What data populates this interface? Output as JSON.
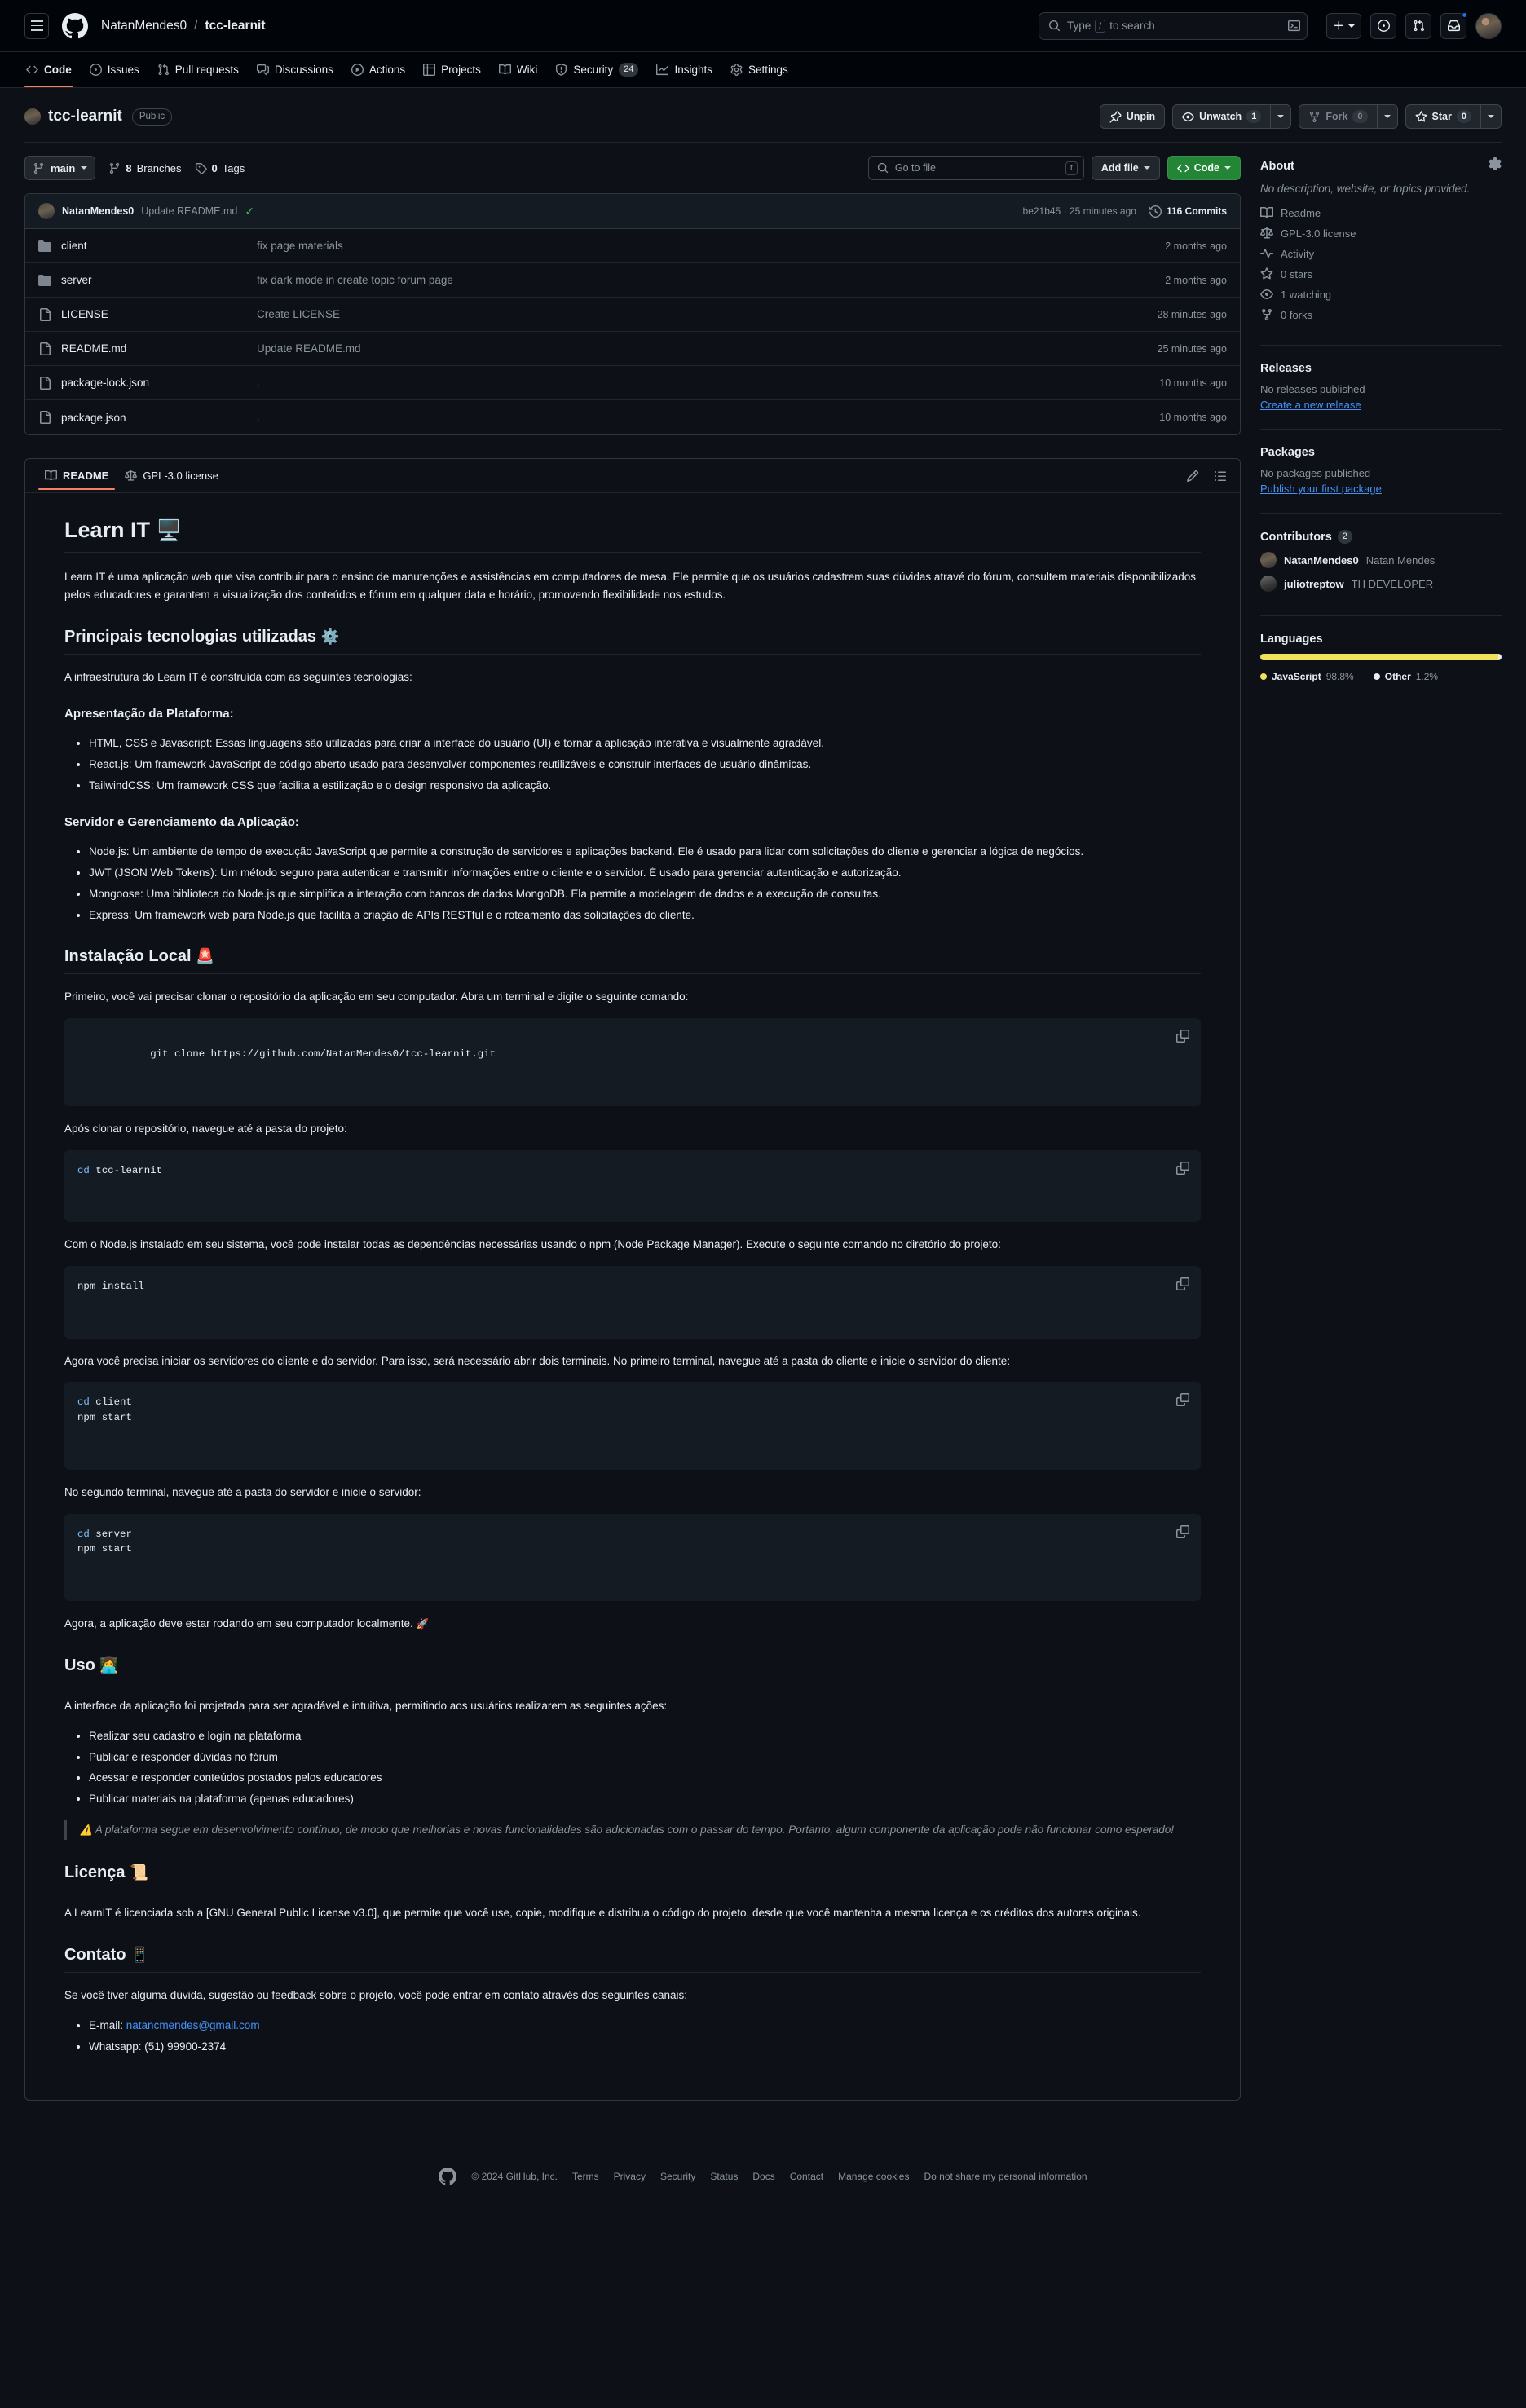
{
  "header": {
    "owner": "NatanMendes0",
    "separator": "/",
    "repo": "tcc-learnit",
    "search_placeholder": "Type",
    "search_key": "/",
    "search_suffix": "to search"
  },
  "repo_nav": [
    {
      "label": "Code",
      "icon": "code-icon",
      "badge": ""
    },
    {
      "label": "Issues",
      "icon": "issue-opened-icon",
      "badge": ""
    },
    {
      "label": "Pull requests",
      "icon": "git-pull-request-icon",
      "badge": ""
    },
    {
      "label": "Discussions",
      "icon": "comment-discussion-icon",
      "badge": ""
    },
    {
      "label": "Actions",
      "icon": "play-icon",
      "badge": ""
    },
    {
      "label": "Projects",
      "icon": "table-icon",
      "badge": ""
    },
    {
      "label": "Wiki",
      "icon": "book-icon",
      "badge": ""
    },
    {
      "label": "Security",
      "icon": "shield-icon",
      "badge": "24"
    },
    {
      "label": "Insights",
      "icon": "graph-icon",
      "badge": ""
    },
    {
      "label": "Settings",
      "icon": "gear-icon",
      "badge": ""
    }
  ],
  "repo_header": {
    "name": "tcc-learnit",
    "visibility": "Public",
    "unpin_label": "Unpin",
    "unwatch_label": "Unwatch",
    "unwatch_count": "1",
    "fork_label": "Fork",
    "fork_count": "0",
    "star_label": "Star",
    "star_count": "0"
  },
  "file_bar": {
    "branch": "main",
    "branches_count": "8",
    "branches_label": "Branches",
    "tags_count": "0",
    "tags_label": "Tags",
    "goto_file_placeholder": "Go to file",
    "goto_file_key": "t",
    "add_file_label": "Add file",
    "code_label": "Code"
  },
  "commit_bar": {
    "author": "NatanMendes0",
    "message": "Update README.md",
    "sha_time": "be21b45 · 25 minutes ago",
    "commits": "116 Commits"
  },
  "files": [
    {
      "type": "dir",
      "name": "client",
      "message": "fix page materials",
      "time": "2 months ago"
    },
    {
      "type": "dir",
      "name": "server",
      "message": "fix dark mode in create topic forum page",
      "time": "2 months ago"
    },
    {
      "type": "file",
      "name": "LICENSE",
      "message": "Create LICENSE",
      "time": "28 minutes ago"
    },
    {
      "type": "file",
      "name": "README.md",
      "message": "Update README.md",
      "time": "25 minutes ago"
    },
    {
      "type": "file",
      "name": "package-lock.json",
      "message": ".",
      "time": "10 months ago"
    },
    {
      "type": "file",
      "name": "package.json",
      "message": ".",
      "time": "10 months ago"
    }
  ],
  "readme_tabs": {
    "readme": "README",
    "license": "GPL-3.0 license"
  },
  "readme": {
    "h1": "Learn IT",
    "h1_emoji": "🖥️",
    "intro": "Learn IT é uma aplicação web que visa contribuir para o ensino de manutenções e assistências em computadores de mesa. Ele permite que os usuários cadastrem suas dúvidas atravé do fórum, consultem materiais disponibilizados pelos educadores e garantem a visualização dos conteúdos e fórum em qualquer data e horário, promovendo flexibilidade nos estudos.",
    "tech_h2": "Principais tecnologias utilizadas",
    "tech_h2_emoji": "⚙️",
    "tech_intro": "A infraestrutura do Learn IT é construída com as seguintes tecnologias:",
    "platform_h3": "Apresentação da Plataforma:",
    "platform_items": [
      "HTML, CSS e Javascript: Essas linguagens são utilizadas para criar a interface do usuário (UI) e tornar a aplicação interativa e visualmente agradável.",
      "React.js: Um framework JavaScript de código aberto usado para desenvolver componentes reutilizáveis e construir interfaces de usuário dinâmicas.",
      "TailwindCSS: Um framework CSS que facilita a estilização e o design responsivo da aplicação."
    ],
    "server_h3": "Servidor e Gerenciamento da Aplicação:",
    "server_items": [
      "Node.js: Um ambiente de tempo de execução JavaScript que permite a construção de servidores e aplicações backend. Ele é usado para lidar com solicitações do cliente e gerenciar a lógica de negócios.",
      "JWT (JSON Web Tokens): Um método seguro para autenticar e transmitir informações entre o cliente e o servidor. É usado para gerenciar autenticação e autorização.",
      "Mongoose: Uma biblioteca do Node.js que simplifica a interação com bancos de dados MongoDB. Ela permite a modelagem de dados e a execução de consultas.",
      "Express: Um framework web para Node.js que facilita a criação de APIs RESTful e o roteamento das solicitações do cliente."
    ],
    "install_h2": "Instalação Local",
    "install_h2_emoji": "🚨",
    "install_p1": "Primeiro, você vai precisar clonar o repositório da aplicação em seu computador. Abra um terminal e digite o seguinte comando:",
    "code1": "git clone https://github.com/NatanMendes0/tcc-learnit.git",
    "install_p2": "Após clonar o repositório, navegue até a pasta do projeto:",
    "code2_kw": "cd",
    "code2_rest": " tcc-learnit",
    "install_p3": "Com o Node.js instalado em seu sistema, você pode instalar todas as dependências necessárias usando o npm (Node Package Manager). Execute o seguinte comando no diretório do projeto:",
    "code3": "npm install",
    "install_p4": "Agora você precisa iniciar os servidores do cliente e do servidor. Para isso, será necessário abrir dois terminais. No primeiro terminal, navegue até a pasta do cliente e inicie o servidor do cliente:",
    "code4_kw": "cd",
    "code4_rest": " client\nnpm start",
    "install_p5": "No segundo terminal, navegue até a pasta do servidor e inicie o servidor:",
    "code5_kw": "cd",
    "code5_rest": " server\nnpm start",
    "install_p6": "Agora, a aplicação deve estar rodando em seu computador localmente.",
    "install_p6_emoji": "🚀",
    "uso_h2": "Uso",
    "uso_h2_emoji": "👩‍💻",
    "uso_intro": "A interface da aplicação foi projetada para ser agradável e intuitiva, permitindo aos usuários realizarem as seguintes ações:",
    "uso_items": [
      "Realizar seu cadastro e login na plataforma",
      "Publicar e responder dúvidas no fórum",
      "Acessar e responder conteúdos postados pelos educadores",
      "Publicar materiais na plataforma (apenas educadores)"
    ],
    "warning_emoji": "⚠️",
    "warning_text": "A plataforma segue em desenvolvimento contínuo, de modo que melhorias e novas funcionalidades são adicionadas com o passar do tempo. Portanto, algum componente da aplicação pode não funcionar como esperado!",
    "licenca_h2": "Licença",
    "licenca_h2_emoji": "📜",
    "licenca_p": "A LearnIT é licenciada sob a [GNU General Public License v3.0], que permite que você use, copie, modifique e distribua o código do projeto, desde que você mantenha a mesma licença e os créditos dos autores originais.",
    "contato_h2": "Contato",
    "contato_h2_emoji": "📱",
    "contato_p": "Se você tiver alguma dúvida, sugestão ou feedback sobre o projeto, você pode entrar em contato através dos seguintes canais:",
    "contato_email_label": "E-mail:",
    "contato_email": "natancmendes@gmail.com",
    "contato_whatsapp": "Whatsapp: (51) 99900-2374"
  },
  "sidebar": {
    "about_title": "About",
    "about_description": "No description, website, or topics provided.",
    "about_links": [
      {
        "label": "Readme",
        "icon": "book-icon"
      },
      {
        "label": "GPL-3.0 license",
        "icon": "law-icon"
      },
      {
        "label": "Activity",
        "icon": "pulse-icon"
      },
      {
        "label": "0 stars",
        "icon": "star-icon",
        "bold": "0"
      },
      {
        "label": "1 watching",
        "icon": "eye-icon",
        "bold": "1"
      },
      {
        "label": "0 forks",
        "icon": "fork-icon",
        "bold": "0"
      }
    ],
    "releases_title": "Releases",
    "releases_empty": "No releases published",
    "releases_link": "Create a new release",
    "packages_title": "Packages",
    "packages_empty": "No packages published",
    "packages_link": "Publish your first package",
    "contributors_title": "Contributors",
    "contributors_count": "2",
    "contributors": [
      {
        "user": "NatanMendes0",
        "name": "Natan Mendes"
      },
      {
        "user": "juliotreptow",
        "name": "TH DEVELOPER"
      }
    ],
    "languages_title": "Languages",
    "languages": [
      {
        "name": "JavaScript",
        "pct": "98.8%",
        "value": 98.8,
        "color": "#f1e05a"
      },
      {
        "name": "Other",
        "pct": "1.2%",
        "value": 1.2,
        "color": "#ededed"
      }
    ]
  },
  "footer": {
    "copyright": "© 2024 GitHub, Inc.",
    "links": [
      "Terms",
      "Privacy",
      "Security",
      "Status",
      "Docs",
      "Contact",
      "Manage cookies",
      "Do not share my personal information"
    ]
  }
}
